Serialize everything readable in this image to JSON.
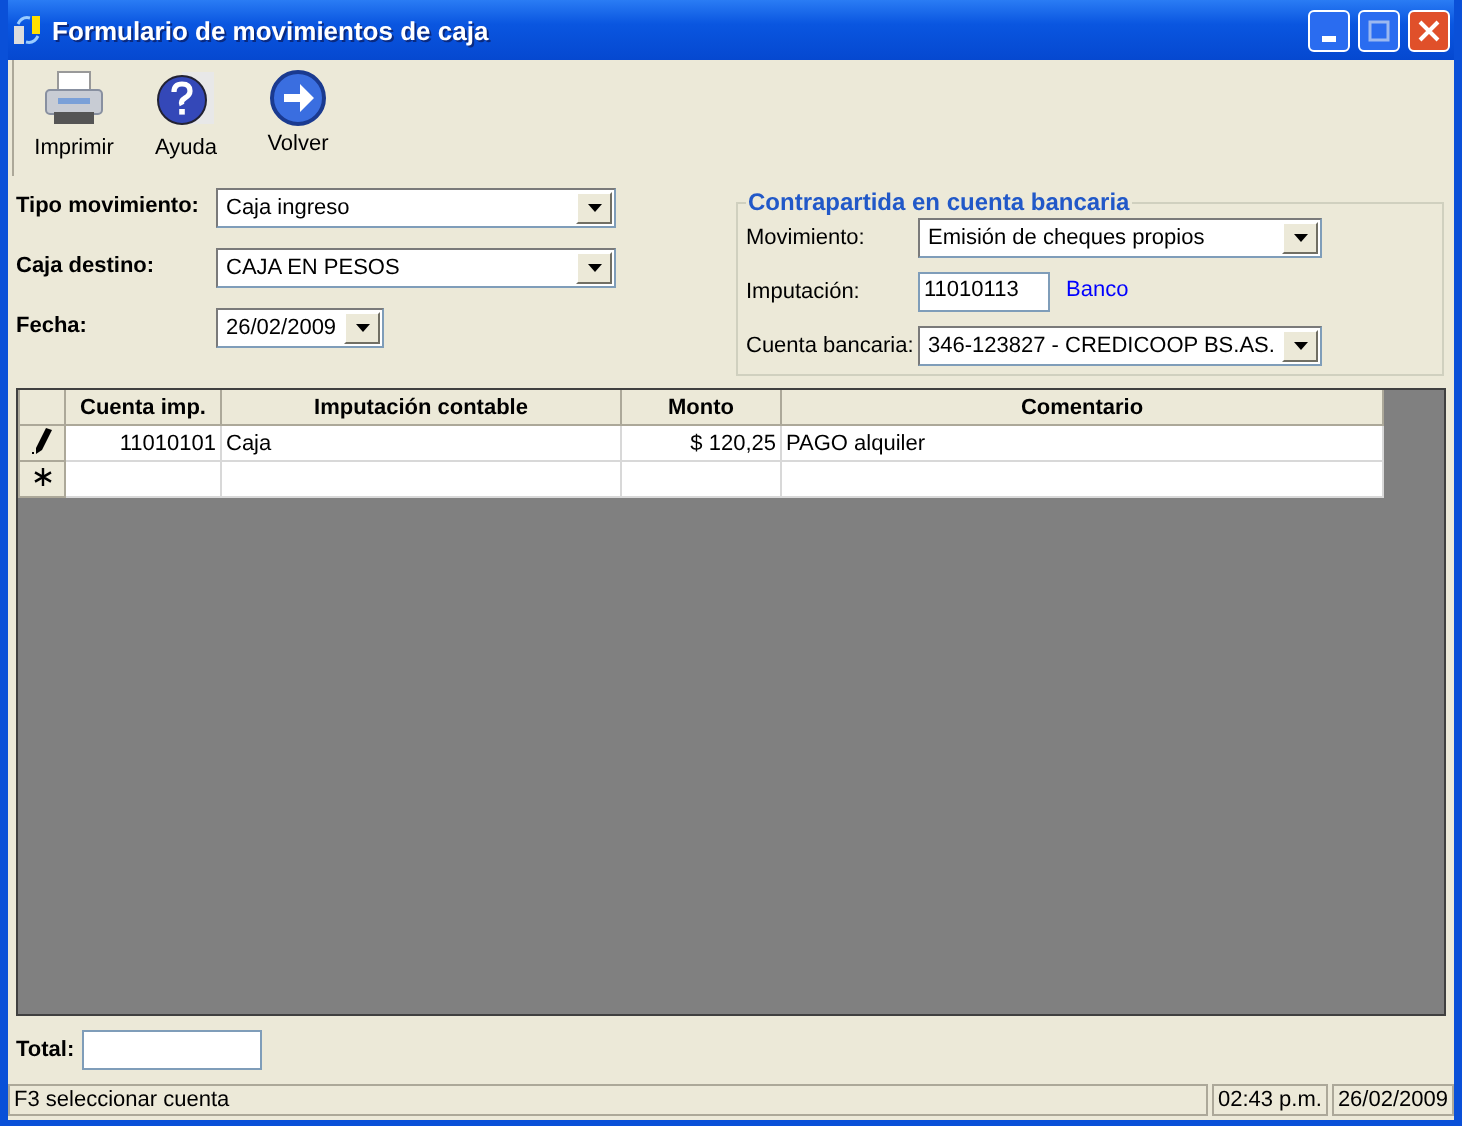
{
  "window": {
    "title": "Formulario de movimientos de caja"
  },
  "toolbar": [
    {
      "kind": "print",
      "label": "Imprimir"
    },
    {
      "kind": "help",
      "label": "Ayuda"
    },
    {
      "kind": "back",
      "label": "Volver"
    }
  ],
  "form": {
    "tipo_movimiento": {
      "label": "Tipo movimiento:",
      "value": "Caja ingreso"
    },
    "caja_destino": {
      "label": "Caja destino:",
      "value": "CAJA EN PESOS"
    },
    "fecha": {
      "label": "Fecha:",
      "value": "26/02/2009"
    }
  },
  "contrapartida": {
    "title": "Contrapartida en cuenta bancaria",
    "movimiento": {
      "label": "Movimiento:",
      "value": "Emisión de cheques propios"
    },
    "imputacion": {
      "label": "Imputación:",
      "value": "11010113",
      "link": "Banco"
    },
    "cuenta_bancaria": {
      "label": "Cuenta bancaria:",
      "value": "346-123827 - CREDICOOP BS.AS."
    }
  },
  "table": {
    "columns": [
      "Cuenta imp.",
      "Imputación contable",
      "Monto",
      "Comentario"
    ],
    "rows": [
      {
        "kind": "editing",
        "cells": [
          "11010101",
          "Caja",
          "$ 120,25",
          "PAGO alquiler"
        ]
      },
      {
        "kind": "new",
        "cells": [
          "",
          "",
          "",
          ""
        ]
      }
    ]
  },
  "total": {
    "label": "Total:"
  },
  "status_bar": {
    "message": "F3 seleccionar cuenta",
    "time": "02:43 p.m.",
    "date": "26/02/2009"
  }
}
